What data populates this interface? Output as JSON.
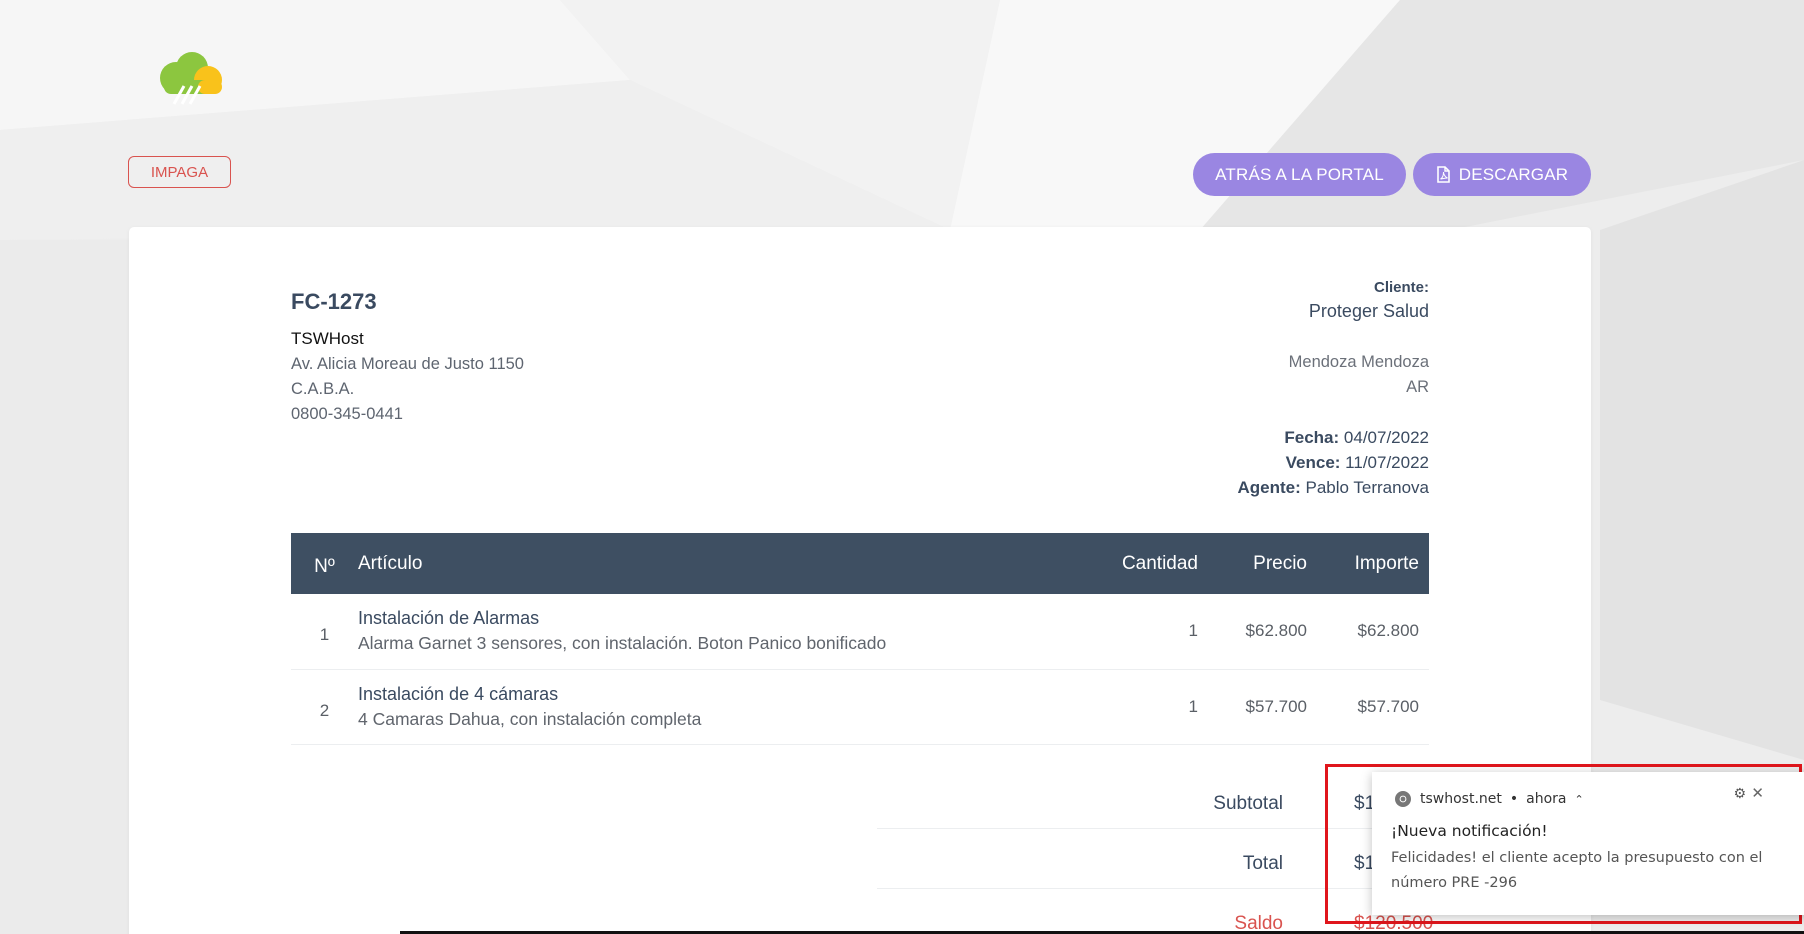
{
  "status_badge": "IMPAGA",
  "buttons": {
    "back_label": "ATRÁS A LA PORTAL",
    "download_label": "DESCARGAR"
  },
  "invoice": {
    "number": "FC-1273",
    "company": {
      "name": "TSWHost",
      "lines": [
        "Av. Alicia Moreau de Justo 1150",
        "C.A.B.A.",
        "0800-345-0441"
      ]
    },
    "client": {
      "label": "Cliente:",
      "name": "Proteger Salud",
      "lines": [
        "Mendoza Mendoza",
        "AR"
      ]
    },
    "meta": [
      {
        "label": "Fecha:",
        "value": "04/07/2022"
      },
      {
        "label": "Vence:",
        "value": "11/07/2022"
      },
      {
        "label": "Agente:",
        "value": "Pablo Terranova"
      }
    ],
    "table": {
      "headers": {
        "num": "Nº",
        "item": "Artículo",
        "qty": "Cantidad",
        "price": "Precio",
        "amount": "Importe"
      },
      "rows": [
        {
          "num": "1",
          "title": "Instalación de Alarmas",
          "desc": "Alarma Garnet 3 sensores, con instalación. Boton Panico bonificado",
          "qty": "1",
          "price": "$62.800",
          "amount": "$62.800"
        },
        {
          "num": "2",
          "title": "Instalación de 4 cámaras",
          "desc": "4 Camaras Dahua, con instalación completa",
          "qty": "1",
          "price": "$57.700",
          "amount": "$57.700"
        }
      ]
    },
    "totals": {
      "subtotal_label": "Subtotal",
      "subtotal_value": "$1",
      "total_label": "Total",
      "total_value": "$1",
      "balance_label": "Saldo",
      "balance_value": "$120.500"
    }
  },
  "notification": {
    "source": "tswhost.net",
    "separator": "•",
    "time": "ahora",
    "title": "¡Nueva notificación!",
    "body": "Felicidades! el cliente acepto la presupuesto con el número PRE -296"
  },
  "colors": {
    "accent": "#9a86e2",
    "header_bg": "#3e4f62",
    "danger": "#d9534f",
    "highlight": "#e0161c"
  }
}
